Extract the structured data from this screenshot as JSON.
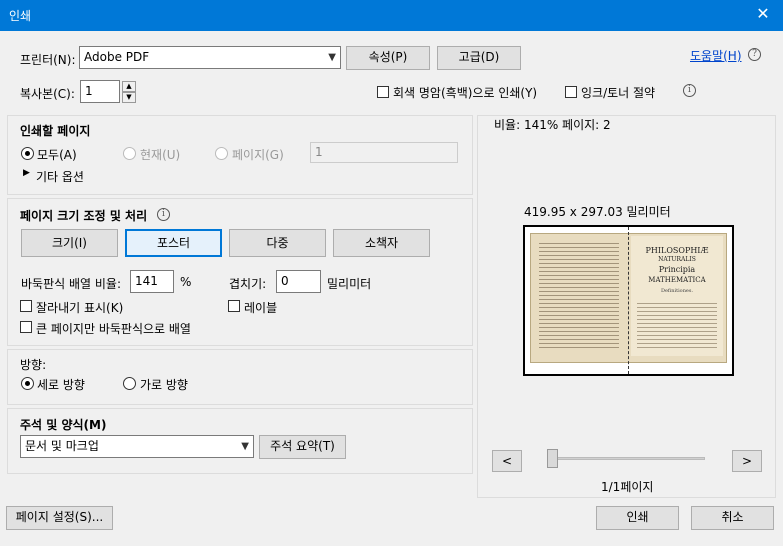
{
  "window": {
    "title": "인쇄",
    "close": "✕"
  },
  "printer": {
    "label": "프린터(N):",
    "value": "Adobe PDF",
    "properties": "속성(P)",
    "advanced": "고급(D)",
    "help": "도움말(H)"
  },
  "copies": {
    "label": "복사본(C):",
    "value": "1"
  },
  "options": {
    "grayscale": "회색 명암(흑백)으로 인쇄(Y)",
    "save_ink": "잉크/토너 절약"
  },
  "pages": {
    "title": "인쇄할 페이지",
    "all": "모두(A)",
    "current": "현재(U)",
    "pages": "페이지(G)",
    "pages_value": "1",
    "more": "기타 옵션"
  },
  "sizing": {
    "title": "페이지 크기 조정 및 처리",
    "buttons": [
      "크기(I)",
      "포스터",
      "다중",
      "소책자"
    ],
    "tile_scale_label": "바둑판식 배열 비율:",
    "tile_scale_value": "141",
    "tile_scale_unit": "%",
    "overlap_label": "겹치기:",
    "overlap_value": "0",
    "overlap_unit": "밀리미터",
    "cut_marks": "잘라내기 표시(K)",
    "labels": "레이블",
    "large_only": "큰 페이지만 바둑판식으로 배열"
  },
  "orientation": {
    "title": "방향:",
    "portrait": "세로 방향",
    "landscape": "가로 방향"
  },
  "comments": {
    "title": "주석 및 양식(M)",
    "value": "문서 및 마크업",
    "summarize": "주석 요약(T)"
  },
  "preview": {
    "status": "비율: 141% 페이지: 2",
    "size": "419.95 x 297.03 밀리미터",
    "book": {
      "line1": "PHILOSOPHIÆ",
      "line2": "NATURALIS",
      "line3": "Principia",
      "line4": "MATHEMATICA",
      "line5": "Definitiones."
    },
    "prev": "<",
    "next": ">",
    "page_counter": "1/1페이지"
  },
  "footer": {
    "page_setup": "페이지 설정(S)...",
    "print": "인쇄",
    "cancel": "취소"
  }
}
